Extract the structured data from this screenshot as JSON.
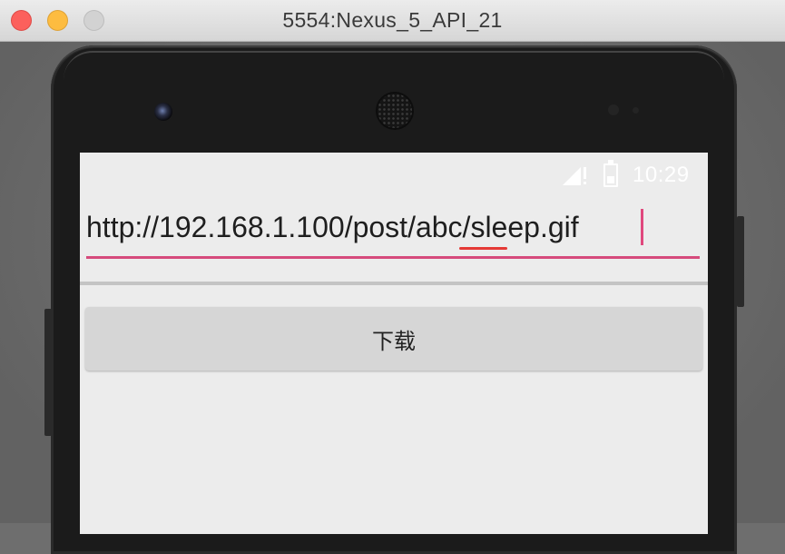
{
  "window": {
    "title": "5554:Nexus_5_API_21"
  },
  "status_bar": {
    "time": "10:29",
    "icons": [
      "signal-no-data-icon",
      "battery-charging-icon"
    ]
  },
  "url_input": {
    "value": "http://192.168.1.100/post/abc/sleep.gif"
  },
  "download_button": {
    "label": "下载"
  },
  "colors": {
    "accent": "#d64a7c",
    "spellcheck": "#e53935"
  }
}
